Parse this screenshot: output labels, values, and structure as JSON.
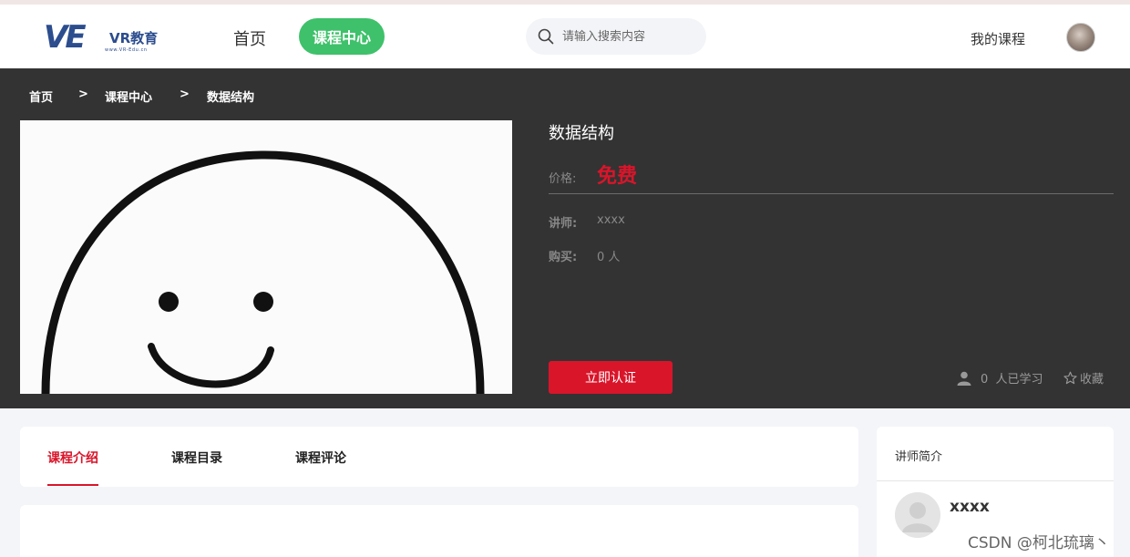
{
  "header": {
    "logo_mark": "VE",
    "logo_brand": "VR教育",
    "logo_site": "www.VR-Edu.cn",
    "nav": {
      "home": "首页",
      "course_center": "课程中心"
    },
    "search": {
      "placeholder": "请输入搜索内容"
    },
    "my_courses": "我的课程"
  },
  "breadcrumb": {
    "items": [
      "首页",
      "课程中心",
      "数据结构"
    ],
    "separator": ">"
  },
  "course": {
    "title": "数据结构",
    "price_label": "价格:",
    "price_value": "免费",
    "teacher_label": "讲师:",
    "teacher_value": "xxxx",
    "buy_label": "购买:",
    "buy_value": "0 人",
    "certify_button": "立即认证",
    "learners": "0  人已学习",
    "favorite": "收藏"
  },
  "tabs": [
    {
      "label": "课程介绍",
      "active": true
    },
    {
      "label": "课程目录",
      "active": false
    },
    {
      "label": "课程评论",
      "active": false
    }
  ],
  "teacher_panel": {
    "title": "讲师简介",
    "name": "xxxx"
  },
  "watermark": "CSDN @柯北琉璃丶",
  "colors": {
    "accent_green": "#3ec16a",
    "accent_red": "#d9152a",
    "banner_bg": "#333333",
    "logo_blue": "#2c4d8e"
  }
}
